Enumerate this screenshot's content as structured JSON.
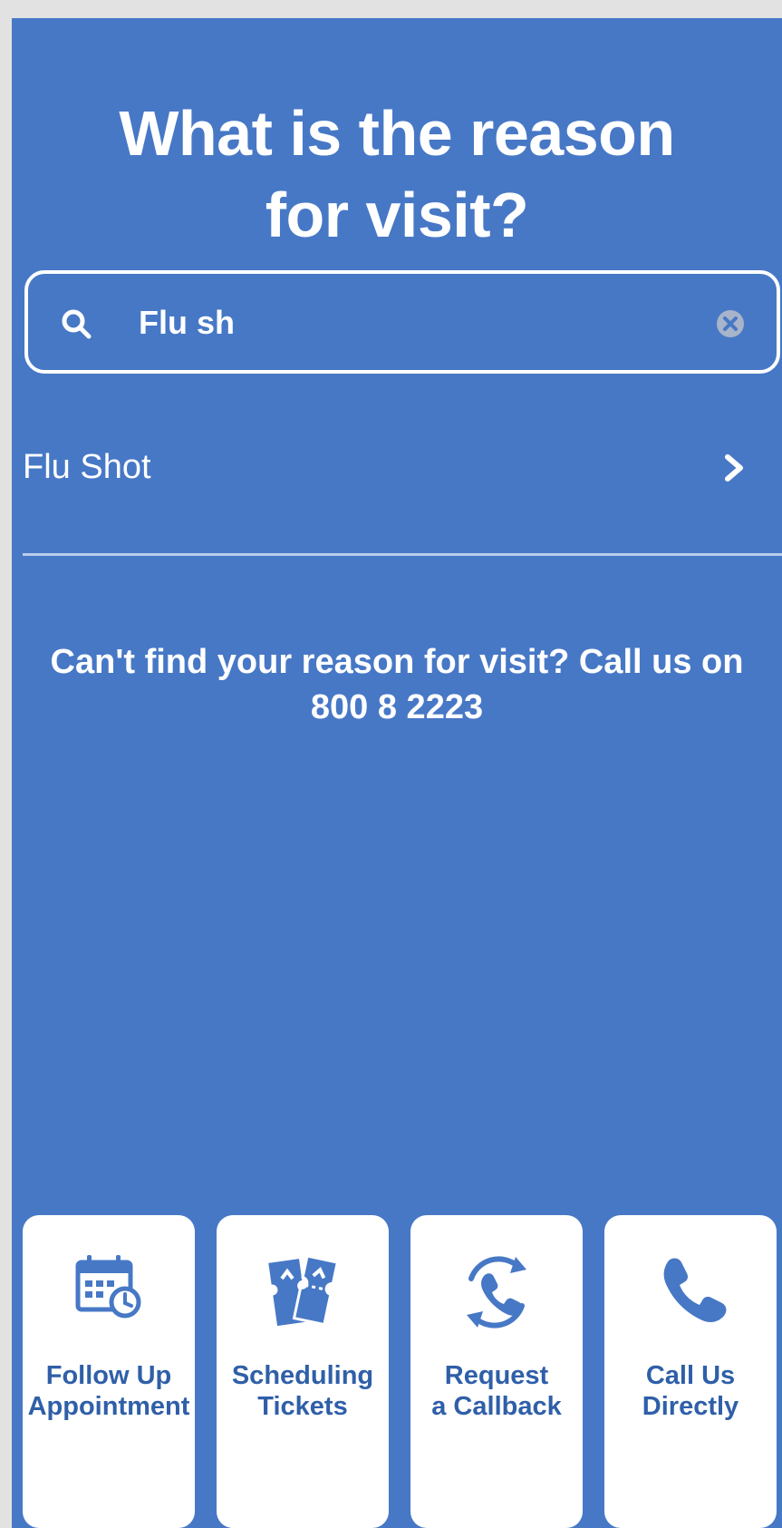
{
  "page": {
    "title_line1": "What is the reason",
    "title_line2": "for visit?"
  },
  "search": {
    "value": "Flu sh",
    "search_icon": "search-icon",
    "clear_icon": "clear-icon"
  },
  "results": [
    {
      "label": "Flu Shot",
      "icon": "chevron-right-icon"
    }
  ],
  "help": {
    "text": "Can't find your reason for visit? Call us on",
    "phone": "800 8 2223"
  },
  "actions": [
    {
      "line1": "Follow Up",
      "line2": "Appointment",
      "icon": "calendar-clock-icon"
    },
    {
      "line1": "Scheduling",
      "line2": "Tickets",
      "icon": "tickets-icon"
    },
    {
      "line1": "Request",
      "line2": "a Callback",
      "icon": "callback-phone-icon"
    },
    {
      "line1": "Call Us",
      "line2": "Directly",
      "icon": "phone-icon"
    }
  ],
  "colors": {
    "background": "#4778c6",
    "tile_text": "#2f5fa8",
    "white": "#ffffff"
  }
}
